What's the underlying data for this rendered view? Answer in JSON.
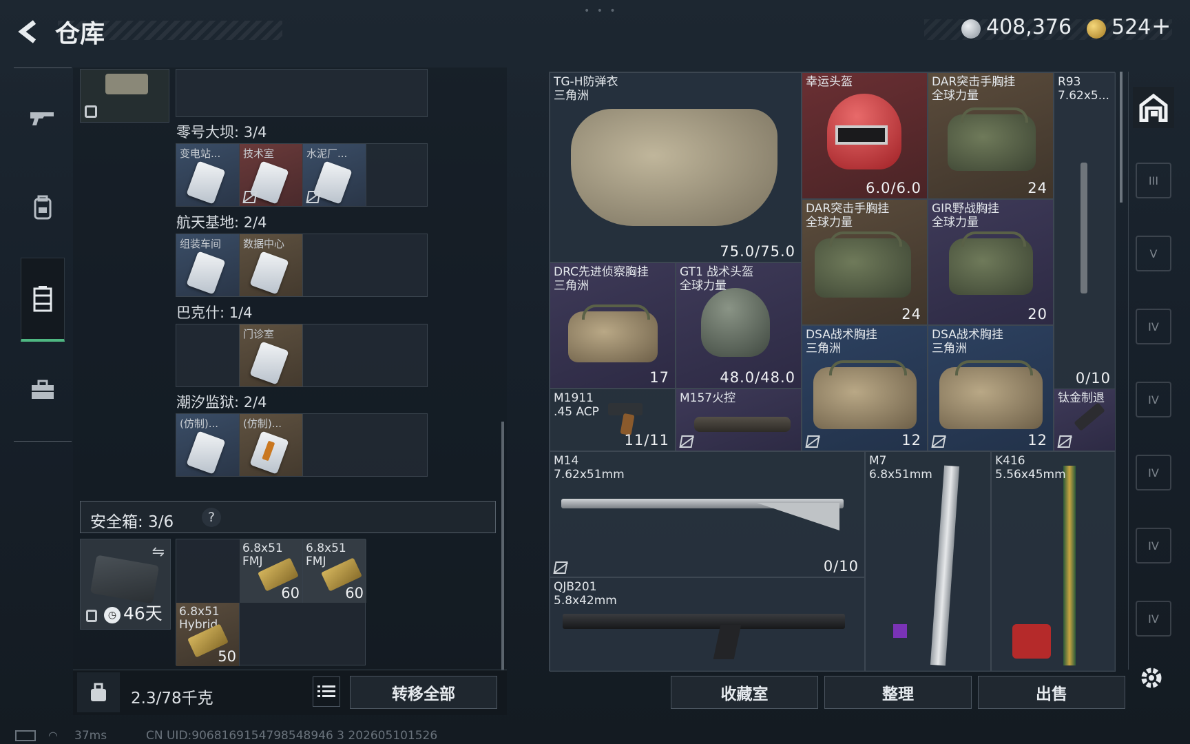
{
  "header": {
    "back_icon": "back-arrow-icon",
    "title": "仓库",
    "currency_1": "408,376",
    "currency_2": "524",
    "currency_2_add": "+"
  },
  "left_rail": {
    "items": [
      {
        "icon": "gun-icon"
      },
      {
        "icon": "backpack-icon"
      },
      {
        "icon": "locker-icon",
        "active": true
      },
      {
        "icon": "briefcase-icon"
      }
    ]
  },
  "keycard_groups": [
    {
      "title": "零号大坝: 3/4",
      "slots": [
        {
          "label": "变电站...",
          "color": "blue",
          "nosell": false
        },
        {
          "label": "技术室",
          "color": "red",
          "nosell": true
        },
        {
          "label": "水泥厂...",
          "color": "blue",
          "nosell": true
        }
      ]
    },
    {
      "title": "航天基地: 2/4",
      "slots": [
        {
          "label": "组装车间",
          "color": "blue"
        },
        {
          "label": "数据中心",
          "color": "gold"
        }
      ]
    },
    {
      "title": "巴克什: 1/4",
      "slots": [
        {
          "label": "",
          "color": "empty"
        },
        {
          "label": "门诊室",
          "color": "gold"
        }
      ]
    },
    {
      "title": "潮汐监狱: 2/4",
      "slots": [
        {
          "label": "(仿制)...",
          "color": "blue"
        },
        {
          "label": "(仿制)...",
          "color": "gold",
          "orange": true
        }
      ]
    }
  ],
  "safebox": {
    "title": "安全箱: 3/6",
    "help": "?",
    "days": "46天",
    "ammo": [
      {
        "label": "6.8x51\nFMJ",
        "count": "60"
      },
      {
        "label": "6.8x51\nFMJ",
        "count": "60"
      },
      {
        "label": "6.8x51\nHybrid",
        "count": "50"
      }
    ]
  },
  "left_footer": {
    "weight": "2.3/78千克",
    "transfer_all": "转移全部"
  },
  "items": {
    "vest": {
      "name": "TG-H防弹衣\n三角洲",
      "value": "75.0/75.0"
    },
    "lucky_helmet": {
      "name": "幸运头盔",
      "value": "6.0/6.0"
    },
    "dar_rig_1": {
      "name": "DAR突击手胸挂\n全球力量",
      "value": "24"
    },
    "r93": {
      "name": "R93\n7.62x5...",
      "value": "0/10"
    },
    "dar_rig_2": {
      "name": "DAR突击手胸挂\n全球力量",
      "value": "24"
    },
    "gir_rig": {
      "name": "GIR野战胸挂\n全球力量",
      "value": "20"
    },
    "drc_rig": {
      "name": "DRC先进侦察胸挂\n三角洲",
      "value": "17"
    },
    "gt1_helmet": {
      "name": "GT1 战术头盔\n全球力量",
      "value": "48.0/48.0"
    },
    "dsa_rig_1": {
      "name": "DSA战术胸挂\n三角洲",
      "value": "12"
    },
    "dsa_rig_2": {
      "name": "DSA战术胸挂\n三角洲",
      "value": "12"
    },
    "m1911": {
      "name": "M1911\n.45 ACP",
      "value": "11/11"
    },
    "m157": {
      "name": "M157火控",
      "value": ""
    },
    "ti_stock": {
      "name": "钛金制退",
      "value": ""
    },
    "m14": {
      "name": "M14\n7.62x51mm",
      "value": "0/10"
    },
    "m7": {
      "name": "M7\n6.8x51mm",
      "value": ""
    },
    "k416": {
      "name": "K416\n5.56x45mm",
      "value": ""
    },
    "qjb201": {
      "name": "QJB201\n5.8x42mm",
      "value": ""
    }
  },
  "right_rail": {
    "top_icon": "home-icon",
    "tiers": [
      "III",
      "V",
      "IV",
      "IV",
      "IV",
      "IV",
      "IV"
    ],
    "settings_icon": "gear-icon"
  },
  "bottom_buttons": {
    "collection": "收藏室",
    "organize": "整理",
    "sell": "出售"
  },
  "status_bar": {
    "ping": "37ms",
    "uid": "CN UID:9068169154798548946 3 202605101526"
  }
}
